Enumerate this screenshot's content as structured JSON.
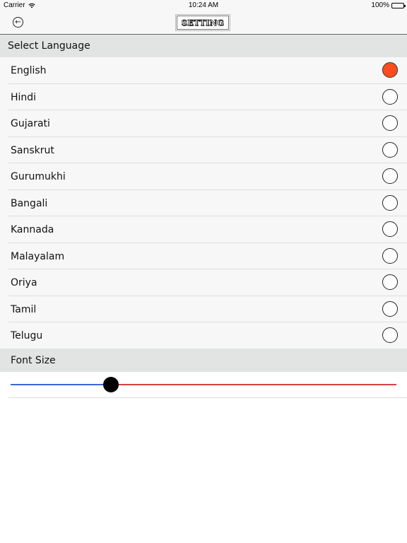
{
  "status": {
    "carrier": "Carrier",
    "time": "10:24 AM",
    "battery": "100%"
  },
  "nav": {
    "title": "SETTING",
    "back_icon": "back-arrow-circle-icon"
  },
  "language_section": {
    "header": "Select Language",
    "selected": "English",
    "items": [
      {
        "label": "English",
        "selected": true
      },
      {
        "label": "Hindi",
        "selected": false
      },
      {
        "label": "Gujarati",
        "selected": false
      },
      {
        "label": "Sanskrut",
        "selected": false
      },
      {
        "label": "Gurumukhi",
        "selected": false
      },
      {
        "label": "Bangali",
        "selected": false
      },
      {
        "label": "Kannada",
        "selected": false
      },
      {
        "label": "Malayalam",
        "selected": false
      },
      {
        "label": "Oriya",
        "selected": false
      },
      {
        "label": "Tamil",
        "selected": false
      },
      {
        "label": "Telugu",
        "selected": false
      }
    ]
  },
  "font_section": {
    "header": "Font Size",
    "slider_value_fraction": 0.26
  },
  "colors": {
    "radio_selected": "#ff4c1f",
    "slider_min_track": "#3a66d6",
    "slider_max_track": "#d84040",
    "section_header_bg": "#e1e4e3"
  }
}
